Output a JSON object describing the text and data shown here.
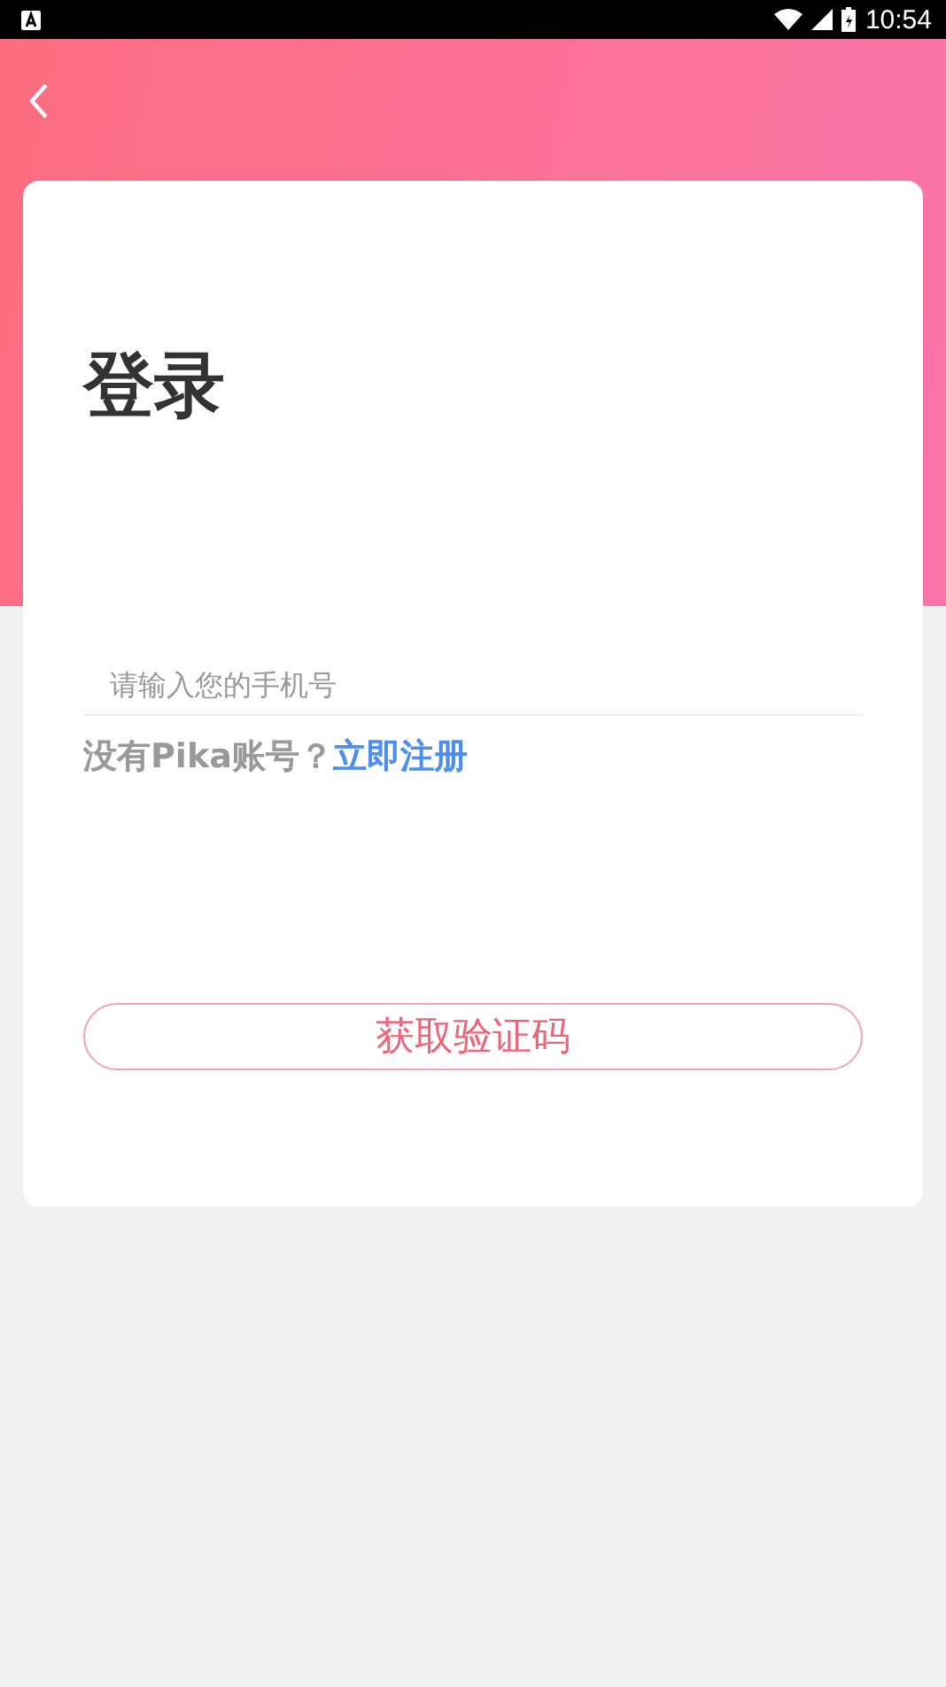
{
  "status_bar": {
    "time": "10:54"
  },
  "title": "登录",
  "phone_field": {
    "placeholder": "请输入您的手机号"
  },
  "register_prompt": {
    "text": "没有Pika账号？",
    "link": "立即注册"
  },
  "submit_button": {
    "label": "获取验证码"
  }
}
